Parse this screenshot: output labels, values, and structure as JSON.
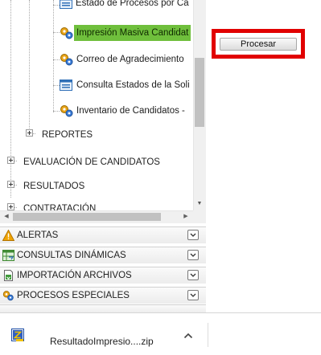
{
  "tree": {
    "items": [
      {
        "label": "Estado de Procesos por Ca",
        "icon": "grid-report-icon"
      },
      {
        "label": "Impresión Masiva Candidat",
        "icon": "gears-icon",
        "selected": true
      },
      {
        "label": "Correo de Agradecimiento",
        "icon": "gears-icon"
      },
      {
        "label": "Consulta Estados de la Soli",
        "icon": "grid-report-icon"
      },
      {
        "label": "Inventario de Candidatos -",
        "icon": "gears-icon"
      }
    ],
    "folders": {
      "reportes": "REPORTES",
      "evaluacion": "EVALUACIÓN DE CANDIDATOS",
      "resultados": "RESULTADOS",
      "contratacion": "CONTRATACIÓN"
    }
  },
  "accordion": {
    "alertas": "ALERTAS",
    "consultas": "CONSULTAS DINÁMICAS",
    "importacion": "IMPORTACIÓN ARCHIVOS",
    "procesos": "PROCESOS ESPECIALES"
  },
  "actions": {
    "procesar_label": "Procesar"
  },
  "downloads": {
    "file_name": "ResultadoImpresio....zip"
  },
  "colors": {
    "selected_bg": "#6fbf3c",
    "highlight_border": "#e10000"
  }
}
